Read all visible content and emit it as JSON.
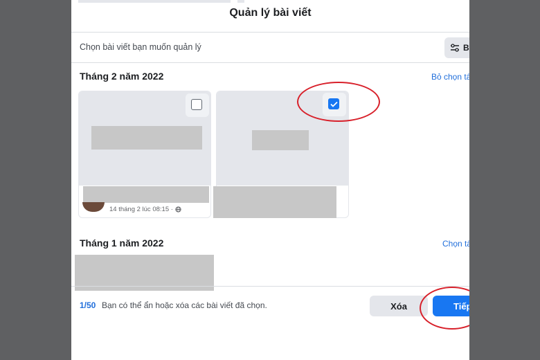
{
  "dialog": {
    "title": "Quản lý bài viết",
    "subtitle": "Chọn bài viết bạn muốn quản lý",
    "filter_label": "Bộ"
  },
  "sections": [
    {
      "title": "Tháng 2 năm 2022",
      "link": "Bỏ chọn tấ",
      "cards": [
        {
          "checked": false,
          "meta": "14 tháng 2 lúc 08:15 ·",
          "privacy_icon": "globe-icon"
        },
        {
          "checked": true
        }
      ]
    },
    {
      "title": "Tháng 1 năm 2022",
      "link": "Chọn tấ"
    }
  ],
  "footer": {
    "count": "1/50",
    "text": "Bạn có thể ẩn hoặc xóa các bài viết đã chọn.",
    "delete_label": "Xóa",
    "next_label": "Tiếp"
  },
  "colors": {
    "primary": "#1877f2",
    "link": "#216fdb",
    "annotation_red": "#d8202a",
    "backdrop": "#5f6062"
  }
}
